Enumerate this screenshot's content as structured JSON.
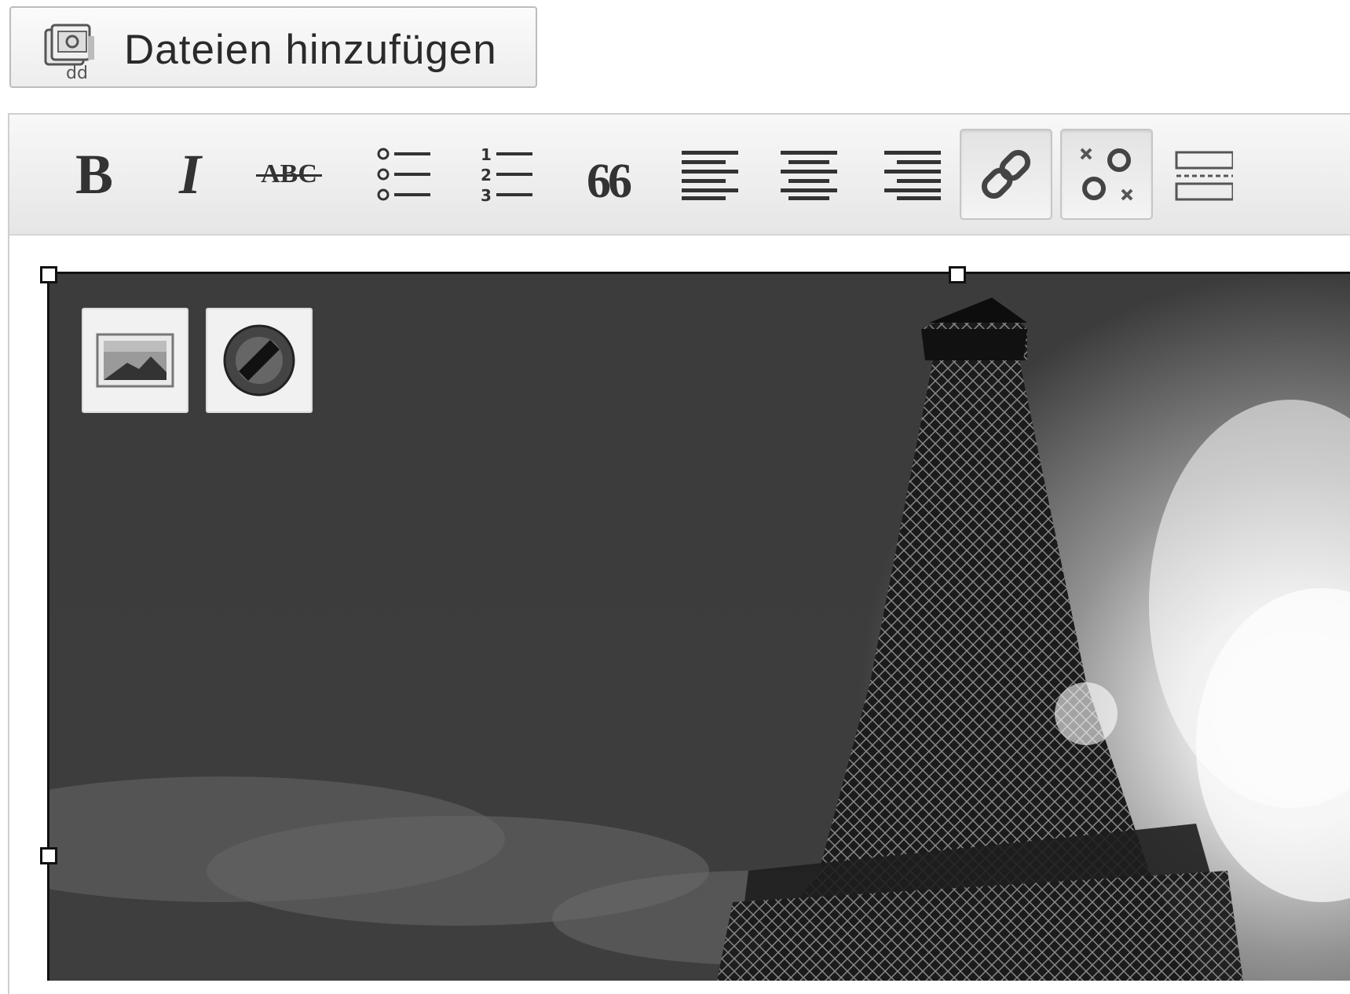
{
  "add_files": {
    "label": "Dateien hinzufügen",
    "icon": "media-upload-icon"
  },
  "toolbar": {
    "bold_label": "B",
    "italic_label": "I",
    "strike_label": "ABC",
    "ordered_list_digits": [
      "1",
      "2",
      "3"
    ],
    "quote_glyph": "66",
    "buttons": [
      "bold",
      "italic",
      "strikethrough",
      "bullet-list",
      "numbered-list",
      "blockquote",
      "align-left",
      "align-center",
      "align-right",
      "insert-link",
      "remove-link",
      "more-tag"
    ],
    "active_buttons": [
      "insert-link",
      "remove-link"
    ]
  },
  "image_overlay": {
    "edit_icon": "edit-image-icon",
    "delete_icon": "delete-image-icon"
  },
  "colors": {
    "toolbar_top": "#f8f8f8",
    "toolbar_bottom": "#e6e6e6",
    "icon": "#333333",
    "photo_sky_dark": "#3a3a3a"
  }
}
